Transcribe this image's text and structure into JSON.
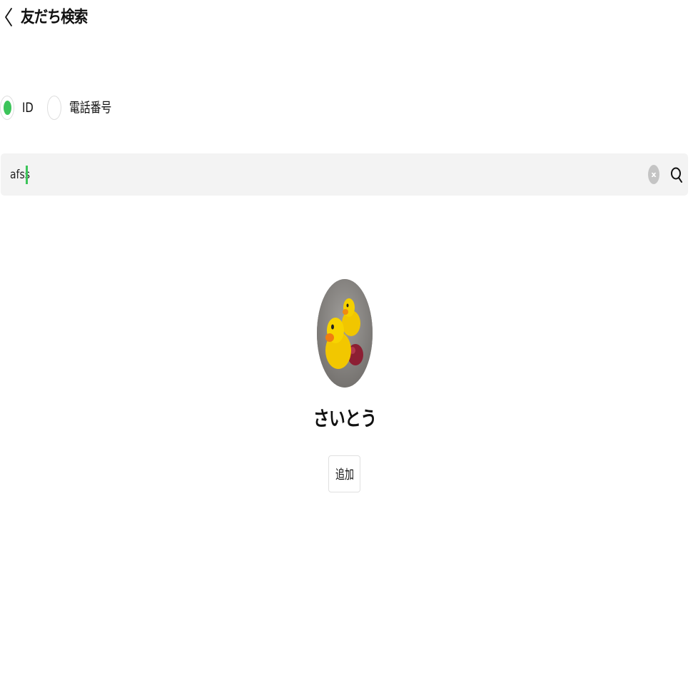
{
  "header": {
    "title": "友だち検索",
    "back_icon": "chevron-left-icon"
  },
  "search_type": {
    "options": [
      {
        "label": "ID",
        "selected": true
      },
      {
        "label": "電話番号",
        "selected": false
      }
    ],
    "accent_color": "#3cc45a"
  },
  "search": {
    "value": "afss",
    "clear_icon": "clear-icon",
    "search_icon": "search-icon",
    "clear_glyph": "x"
  },
  "result": {
    "avatar_icon": "rubber-ducks-avatar",
    "name": "さいとう",
    "add_label": "追加"
  }
}
